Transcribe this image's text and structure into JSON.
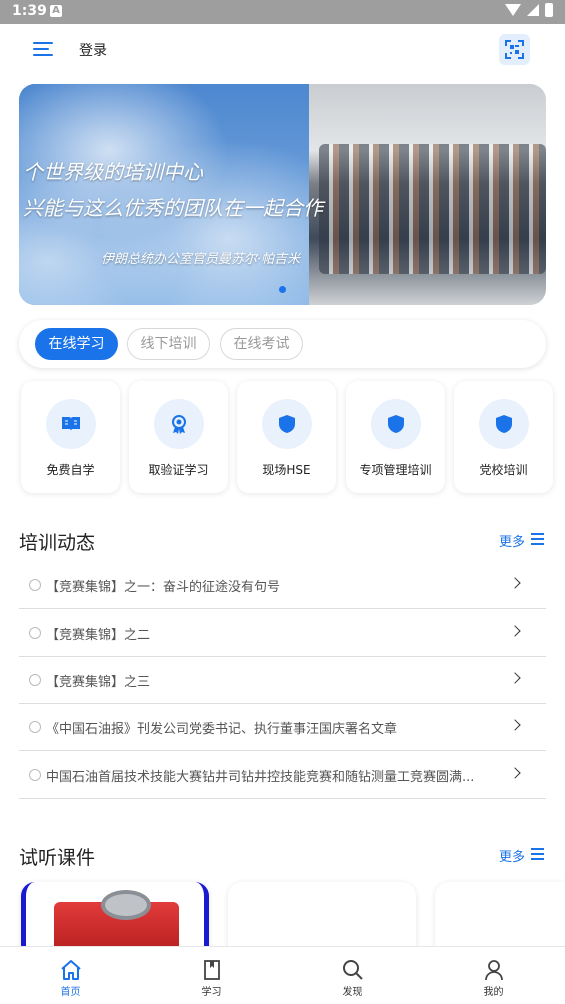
{
  "status_bar": {
    "time": "1:39",
    "notif_glyph": "A"
  },
  "header": {
    "login_label": "登录",
    "menu_icon": "menu-icon",
    "scan_icon": "scan-icon"
  },
  "banner": {
    "line1": "个世界级的培训中心",
    "line2": "兴能与这么优秀的团队在一起合作",
    "line3": "伊朗总统办公室官员曼苏尔·帕吉米",
    "page_indicator": {
      "current": 1,
      "total": 1
    }
  },
  "tabs": [
    {
      "label": "在线学习",
      "active": true
    },
    {
      "label": "线下培训",
      "active": false
    },
    {
      "label": "在线考试",
      "active": false
    }
  ],
  "categories": [
    {
      "label": "免费自学",
      "icon": "book-icon"
    },
    {
      "label": "取验证学习",
      "icon": "badge-icon"
    },
    {
      "label": "现场HSE",
      "icon": "shield-icon"
    },
    {
      "label": "专项管理培训",
      "icon": "shield-icon"
    },
    {
      "label": "党校培训",
      "icon": "shield-icon"
    }
  ],
  "news_section": {
    "title": "培训动态",
    "more_label": "更多",
    "items": [
      "【竞赛集锦】之一：奋斗的征途没有句号",
      "【竞赛集锦】之二",
      "【竞赛集锦】之三",
      "《中国石油报》刊发公司党委书记、执行董事汪国庆署名文章",
      "中国石油首届技术技能大赛钻井司钻井控技能竞赛和随钻测量工竞赛圆满..."
    ]
  },
  "course_section": {
    "title": "试听课件",
    "more_label": "更多"
  },
  "bottom_nav": [
    {
      "label": "首页",
      "icon": "home-icon",
      "active": true
    },
    {
      "label": "学习",
      "icon": "bookmark-icon",
      "active": false
    },
    {
      "label": "发现",
      "icon": "search-icon",
      "active": false
    },
    {
      "label": "我的",
      "icon": "user-icon",
      "active": false
    }
  ],
  "colors": {
    "accent": "#1a73e8",
    "status_bar": "#9e9e9e"
  }
}
